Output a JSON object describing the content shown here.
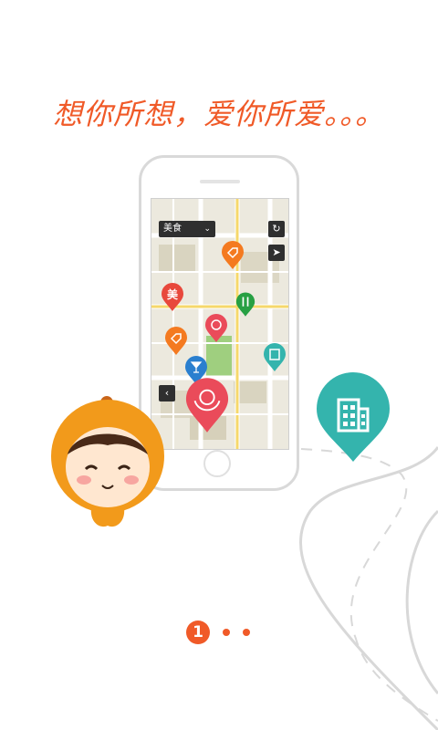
{
  "headline": "想你所想，爱你所爱。。。",
  "map": {
    "category": "美食",
    "chevron_icon": "chevron-down-icon",
    "refresh_icon": "refresh-icon",
    "locate_icon": "navigation-arrow-icon",
    "back_icon": "chevron-left-icon"
  },
  "pins": [
    {
      "name": "tag-pin",
      "icon": "tag-icon",
      "color": "#f47a20"
    },
    {
      "name": "food-pin",
      "label": "美",
      "icon": "text-badge",
      "color": "#e8483c"
    },
    {
      "name": "restaurant-pin",
      "icon": "fork-knife-icon",
      "color": "#27a043"
    },
    {
      "name": "flower-pin",
      "icon": "flower-icon",
      "color": "#ea4b5a"
    },
    {
      "name": "coupon-pin",
      "icon": "tag-icon",
      "color": "#f47a20"
    },
    {
      "name": "bar-pin",
      "icon": "cocktail-icon",
      "color": "#2a7fcf"
    },
    {
      "name": "hotel-pin",
      "icon": "building-icon",
      "color": "#34b4ad"
    },
    {
      "name": "selected-flower-pin",
      "icon": "flower-icon",
      "color": "#ea4b5a"
    }
  ],
  "featured_pin": {
    "icon": "building-icon",
    "color": "#34b4ad"
  },
  "pager": {
    "current": "1",
    "total_pages": 3,
    "accent": "#f05a28"
  },
  "colors": {
    "accent": "#f05a28",
    "road": "#d8d8d8",
    "mascot": "#f29a1b"
  }
}
